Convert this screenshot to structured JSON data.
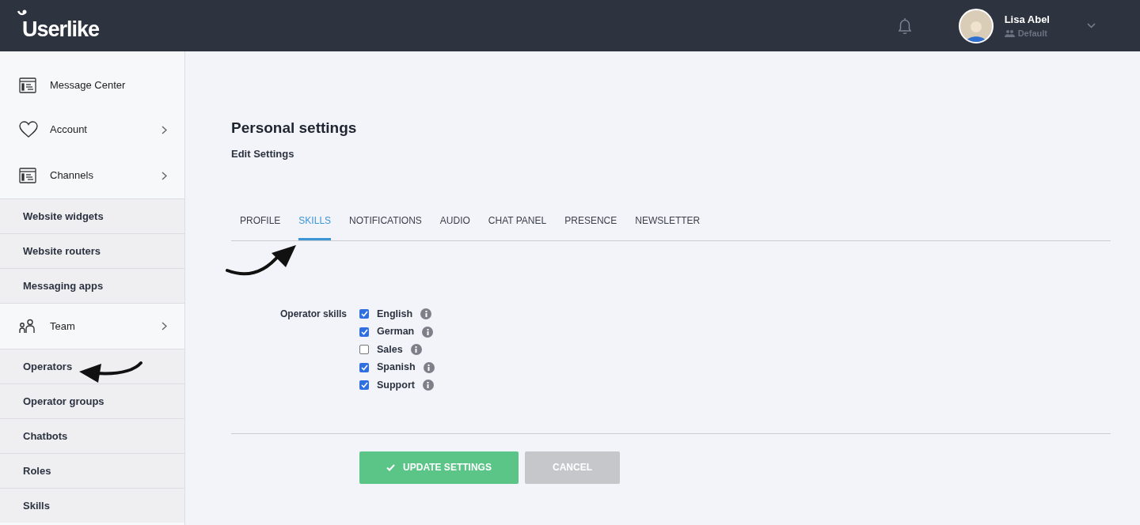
{
  "header": {
    "logo": "Userlike",
    "user": {
      "name": "Lisa Abel",
      "group": "Default"
    }
  },
  "sidebar": {
    "items": [
      {
        "kind": "section",
        "label": "Message Center",
        "chevron": false
      },
      {
        "kind": "section",
        "label": "Account",
        "chevron": true
      },
      {
        "kind": "section",
        "label": "Channels",
        "chevron": true
      },
      {
        "kind": "subitem",
        "label": "Website widgets"
      },
      {
        "kind": "subitem",
        "label": "Website routers"
      },
      {
        "kind": "subitem",
        "label": "Messaging apps"
      },
      {
        "kind": "section",
        "label": "Team",
        "chevron": true
      },
      {
        "kind": "subitem",
        "label": "Operators"
      },
      {
        "kind": "subitem",
        "label": "Operator groups"
      },
      {
        "kind": "subitem",
        "label": "Chatbots"
      },
      {
        "kind": "subitem",
        "label": "Roles"
      },
      {
        "kind": "subitem",
        "label": "Skills"
      }
    ]
  },
  "page": {
    "title": "Personal settings",
    "subtitle": "Edit Settings"
  },
  "tabs": [
    {
      "label": "PROFILE",
      "selected": false
    },
    {
      "label": "SKILLS",
      "selected": true
    },
    {
      "label": "NOTIFICATIONS",
      "selected": false
    },
    {
      "label": "AUDIO",
      "selected": false
    },
    {
      "label": "CHAT PANEL",
      "selected": false
    },
    {
      "label": "PRESENCE",
      "selected": false
    },
    {
      "label": "NEWSLETTER",
      "selected": false
    }
  ],
  "skills": {
    "label": "Operator skills",
    "options": [
      {
        "label": "English",
        "checked": true
      },
      {
        "label": "German",
        "checked": true
      },
      {
        "label": "Sales",
        "checked": false
      },
      {
        "label": "Spanish",
        "checked": true
      },
      {
        "label": "Support",
        "checked": true
      }
    ]
  },
  "buttons": {
    "update": "UPDATE SETTINGS",
    "cancel": "CANCEL"
  }
}
